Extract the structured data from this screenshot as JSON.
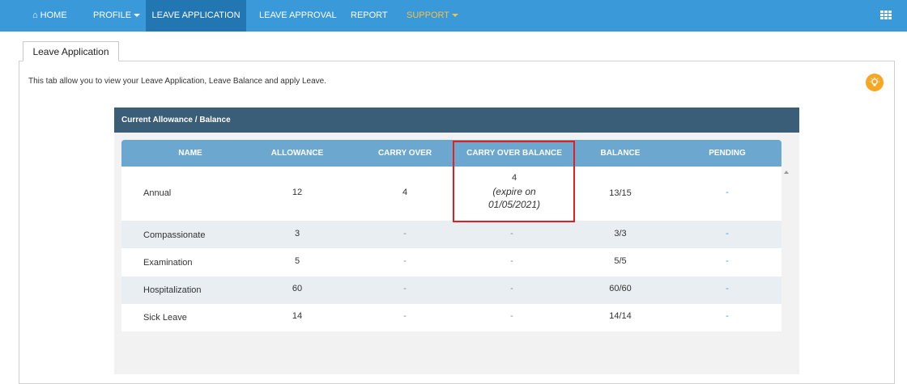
{
  "nav": {
    "home": "HOME",
    "profile": "PROFILE",
    "leave_application": "LEAVE APPLICATION",
    "leave_approval": "LEAVE APPROVAL",
    "report": "REPORT",
    "support": "SUPPORT",
    "apps_icon": "grid-icon"
  },
  "colors": {
    "nav_bg": "#3a99d8",
    "nav_active": "#2276b2",
    "support": "#f5c04a",
    "panel_header": "#3b5e78",
    "table_header": "#6ba7cf",
    "highlight": "#e02020"
  },
  "tab": {
    "label": "Leave Application"
  },
  "description": "This tab allow you to view your Leave Application, Leave Balance and apply Leave.",
  "allowance": {
    "title": "Current Allowance / Balance",
    "columns": [
      "NAME",
      "ALLOWANCE",
      "CARRY OVER",
      "CARRY OVER BALANCE",
      "BALANCE",
      "PENDING"
    ],
    "rows": [
      {
        "name": "Annual",
        "allowance": "12",
        "carry_over": "4",
        "carry_over_balance": "4",
        "carry_over_note": "(expire on",
        "carry_over_date": "01/05/2021)",
        "balance": "13/15",
        "pending": "-"
      },
      {
        "name": "Compassionate",
        "allowance": "3",
        "carry_over": "-",
        "carry_over_balance": "-",
        "balance": "3/3",
        "pending": "-"
      },
      {
        "name": "Examination",
        "allowance": "5",
        "carry_over": "-",
        "carry_over_balance": "-",
        "balance": "5/5",
        "pending": "-"
      },
      {
        "name": "Hospitalization",
        "allowance": "60",
        "carry_over": "-",
        "carry_over_balance": "-",
        "balance": "60/60",
        "pending": "-"
      },
      {
        "name": "Sick Leave",
        "allowance": "14",
        "carry_over": "-",
        "carry_over_balance": "-",
        "balance": "14/14",
        "pending": "-"
      }
    ]
  }
}
